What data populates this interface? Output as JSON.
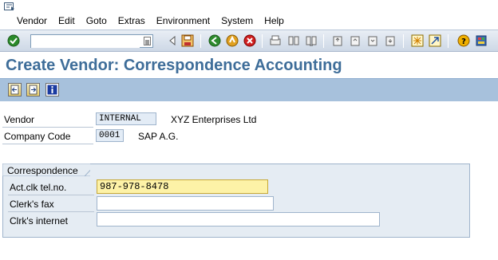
{
  "menubar": {
    "items": [
      {
        "label": "Vendor"
      },
      {
        "label": "Edit"
      },
      {
        "label": "Goto"
      },
      {
        "label": "Extras"
      },
      {
        "label": "Environment"
      },
      {
        "label": "System"
      },
      {
        "label": "Help"
      }
    ]
  },
  "toolbar": {
    "command_field_value": "",
    "icons": [
      "enter-icon",
      "back-icon",
      "save-icon",
      "back-green-icon",
      "exit-icon",
      "cancel-icon",
      "print-icon",
      "find-icon",
      "find-next-icon",
      "first-page-icon",
      "previous-page-icon",
      "next-page-icon",
      "last-page-icon",
      "create-session-icon",
      "shortcut-icon",
      "help-icon",
      "layout-icon"
    ]
  },
  "title": "Create Vendor: Correspondence Accounting",
  "app_toolbar": {
    "icons": [
      "previous-screen-icon",
      "next-screen-icon",
      "information-icon"
    ]
  },
  "header_fields": {
    "vendor_label": "Vendor",
    "vendor_value": "INTERNAL",
    "vendor_name": "XYZ Enterprises Ltd",
    "company_code_label": "Company Code",
    "company_code_value": "0001",
    "company_name": "SAP A.G."
  },
  "correspondence": {
    "title": "Correspondence",
    "clerk_tel_label": "Act.clk tel.no.",
    "clerk_tel_value": "987-978-8478",
    "clerk_fax_label": "Clerk's fax",
    "clerk_fax_value": "",
    "clerk_internet_label": "Clrk's internet",
    "clerk_internet_value": ""
  },
  "colors": {
    "title": "#3e6d99",
    "app_toolbar": "#a7c1dc",
    "active_field": "#fdf2a7"
  }
}
